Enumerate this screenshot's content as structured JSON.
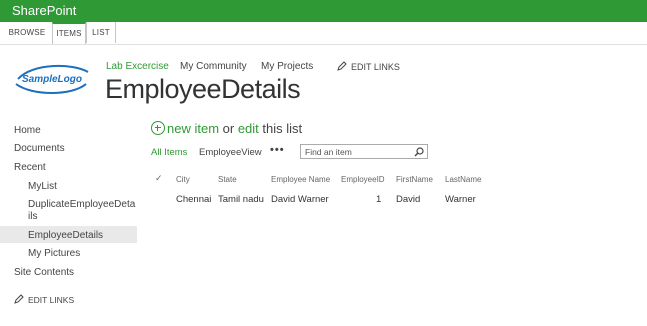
{
  "app": {
    "brand": "SharePoint"
  },
  "ribbon": {
    "tabs": [
      "BROWSE",
      "ITEMS",
      "LIST"
    ],
    "active": "ITEMS"
  },
  "logo": {
    "text": "SampleLogo"
  },
  "topnav": {
    "items": [
      "Lab Excercise",
      "My Community",
      "My Projects"
    ],
    "selected": "Lab Excercise",
    "edit_links": "EDIT LINKS"
  },
  "page": {
    "title": "EmployeeDetails"
  },
  "leftnav": {
    "items": [
      "Home",
      "Documents",
      "Recent"
    ],
    "recent": [
      "MyList",
      "DuplicateEmployeeDeta",
      "ils",
      "EmployeeDetails",
      "My Pictures"
    ],
    "site_contents": "Site Contents",
    "selected": "EmployeeDetails",
    "edit_links": "EDIT LINKS"
  },
  "list": {
    "new_item": "new item",
    "or": " or ",
    "edit": "edit",
    "this_list": " this list",
    "views": [
      "All Items",
      "EmployeeView"
    ],
    "selected_view": "All Items",
    "more": "•••",
    "search_placeholder": "Find an item",
    "check_col": "✓",
    "columns": [
      "City",
      "State",
      "Employee Name",
      "EmployeeID",
      "FirstName",
      "LastName"
    ],
    "rows": [
      [
        "Chennai",
        "Tamil nadu",
        "David Warner",
        "1",
        "David",
        "Warner"
      ]
    ]
  },
  "colors": {
    "accent": "#2f9a35",
    "selected_bg": "#e9e9e9"
  }
}
